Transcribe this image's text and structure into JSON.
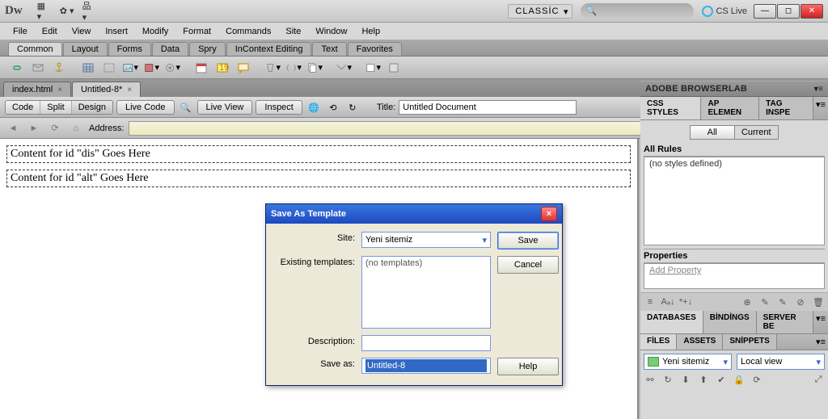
{
  "app": {
    "logo": "Dw",
    "workspace": "CLASSİC",
    "cslive": "CS Live"
  },
  "menubar": [
    "File",
    "Edit",
    "View",
    "Insert",
    "Modify",
    "Format",
    "Commands",
    "Site",
    "Window",
    "Help"
  ],
  "insertTabs": [
    "Common",
    "Layout",
    "Forms",
    "Data",
    "Spry",
    "InContext Editing",
    "Text",
    "Favorites"
  ],
  "docTabs": [
    {
      "label": "index.html",
      "active": false
    },
    {
      "label": "Untitled-8*",
      "active": true
    }
  ],
  "viewModes": {
    "code": "Code",
    "split": "Split",
    "design": "Design"
  },
  "docToolbar": {
    "liveCode": "Live Code",
    "liveView": "Live View",
    "inspect": "Inspect",
    "titleLabel": "Title:",
    "titleValue": "Untitled Document"
  },
  "addressLabel": "Address:",
  "content": {
    "line1": "Content for id \"dis\" Goes Here",
    "line2": "Content for id \"alt\" Goes Here"
  },
  "panels": {
    "browserlab": "ADOBE BROWSERLAB",
    "cssTabs": [
      "CSS STYLES",
      "AP ELEMEN",
      "TAG INSPE"
    ],
    "all": "All",
    "current": "Current",
    "allRules": "All Rules",
    "noStyles": "(no styles defined)",
    "properties": "Properties",
    "addProperty": "Add Property",
    "dbTabs": [
      "DATABASES",
      "BİNDİNGS",
      "SERVER BE"
    ],
    "fileTabs": [
      "FİLES",
      "ASSETS",
      "SNİPPETS"
    ],
    "siteCombo": "Yeni sitemiz",
    "viewCombo": "Local view"
  },
  "dialog": {
    "title": "Save As Template",
    "siteLabel": "Site:",
    "siteValue": "Yeni sitemiz",
    "existingLabel": "Existing templates:",
    "existingValue": "(no templates)",
    "descLabel": "Description:",
    "saveAsLabel": "Save as:",
    "saveAsValue": "Untitled-8",
    "save": "Save",
    "cancel": "Cancel",
    "help": "Help"
  }
}
